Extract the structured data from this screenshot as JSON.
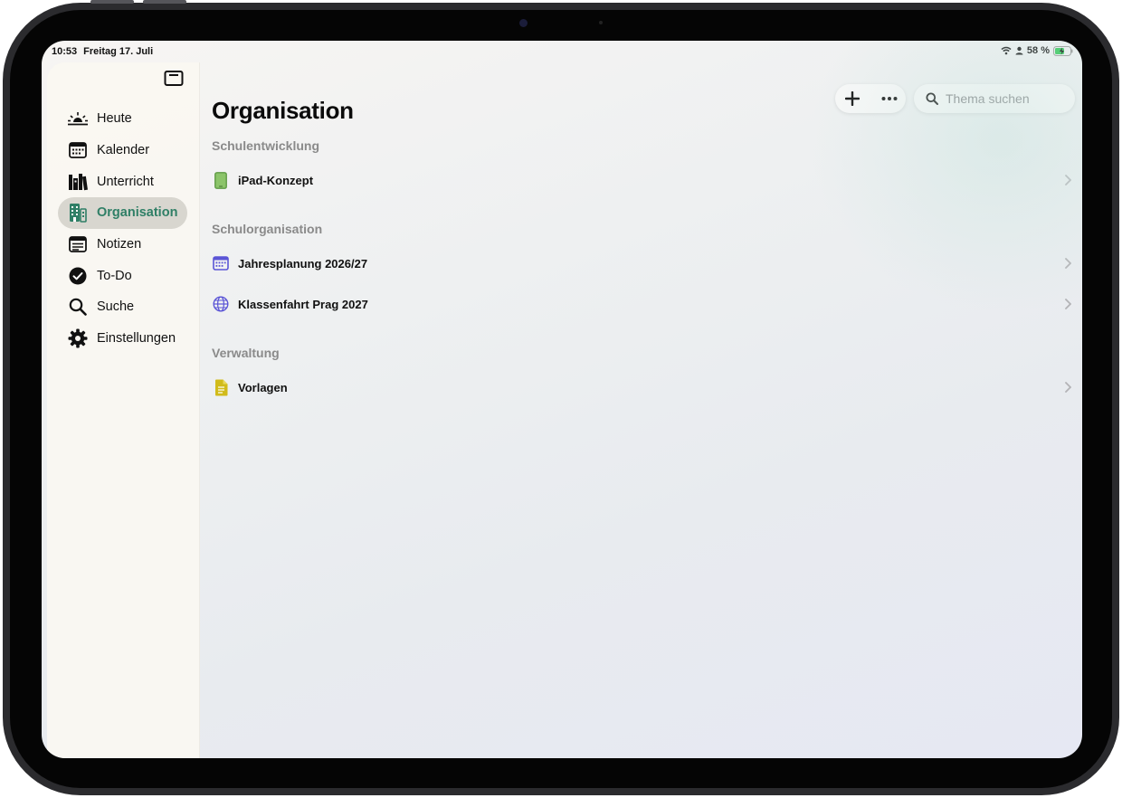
{
  "status_bar": {
    "time": "10:53",
    "date": "Freitag 17. Juli",
    "battery": "58 %"
  },
  "sidebar": {
    "items": [
      {
        "label": "Heute",
        "icon": "sunrise-icon"
      },
      {
        "label": "Kalender",
        "icon": "calendar-icon"
      },
      {
        "label": "Unterricht",
        "icon": "books-icon"
      },
      {
        "label": "Organisation",
        "icon": "building-icon",
        "active": true
      },
      {
        "label": "Notizen",
        "icon": "note-icon"
      },
      {
        "label": "To-Do",
        "icon": "checkmark-circle-icon"
      },
      {
        "label": "Suche",
        "icon": "search-icon"
      },
      {
        "label": "Einstellungen",
        "icon": "gear-icon"
      }
    ]
  },
  "main": {
    "title": "Organisation",
    "search_placeholder": "Thema suchen",
    "sections": [
      {
        "header": "Schulentwicklung",
        "rows": [
          {
            "label": "iPad-Konzept",
            "icon": "ipad-icon",
            "color": "#6aa84f"
          }
        ]
      },
      {
        "header": "Schulorganisation",
        "rows": [
          {
            "label": "Jahresplanung 2026/27",
            "icon": "calendar-icon",
            "color": "#5b55d6"
          },
          {
            "label": "Klassenfahrt Prag 2027",
            "icon": "globe-icon",
            "color": "#5b55d6"
          }
        ]
      },
      {
        "header": "Verwaltung",
        "rows": [
          {
            "label": "Vorlagen",
            "icon": "document-icon",
            "color": "#c9b400"
          }
        ]
      }
    ]
  },
  "colors": {
    "accent": "#2f7f66",
    "active_bg": "#d8d6cf"
  }
}
